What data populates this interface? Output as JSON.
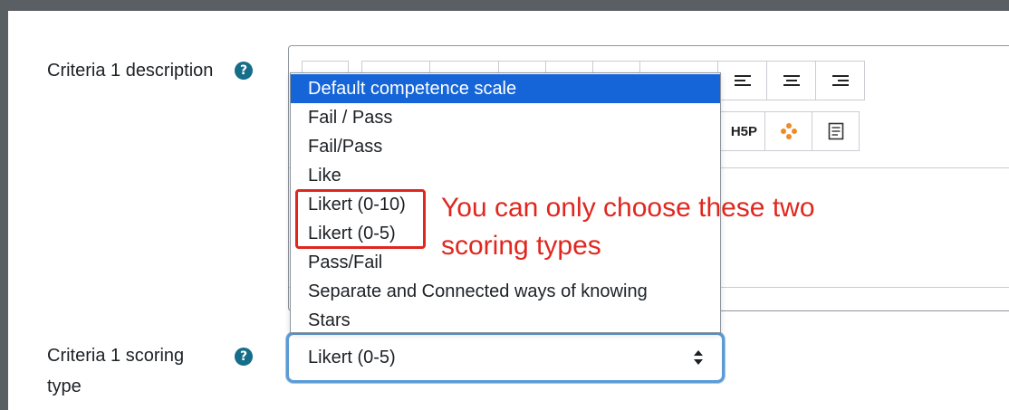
{
  "criteria_description_label": "Criteria 1 description",
  "criteria_scoring_label_line1": "Criteria 1 scoring",
  "criteria_scoring_label_line2": "type",
  "help_icon_glyph": "?",
  "toolbar": {
    "h5p_label": "H5P"
  },
  "dropdown": {
    "options": [
      {
        "label": "Default competence scale",
        "selected": true
      },
      {
        "label": "Fail / Pass",
        "selected": false
      },
      {
        "label": "Fail/Pass",
        "selected": false
      },
      {
        "label": "Like",
        "selected": false
      },
      {
        "label": "Likert (0-10)",
        "selected": false
      },
      {
        "label": "Likert (0-5)",
        "selected": false
      },
      {
        "label": "Pass/Fail",
        "selected": false
      },
      {
        "label": "Separate and Connected ways of knowing",
        "selected": false
      },
      {
        "label": "Stars",
        "selected": false
      }
    ]
  },
  "annotation": {
    "line1": "You can only choose these two",
    "line2": "scoring types"
  },
  "select": {
    "value": "Likert (0-5)"
  },
  "colors": {
    "accent": "#1565d8",
    "annotation": "#e0271f",
    "help_icon": "#156d8a",
    "focus_border": "#5b9bd5"
  },
  "icons": [
    "help-icon",
    "align-left-icon",
    "align-center-icon",
    "align-right-icon",
    "h5p-icon",
    "moodlenet-icon",
    "template-icon",
    "select-caret-icon"
  ]
}
